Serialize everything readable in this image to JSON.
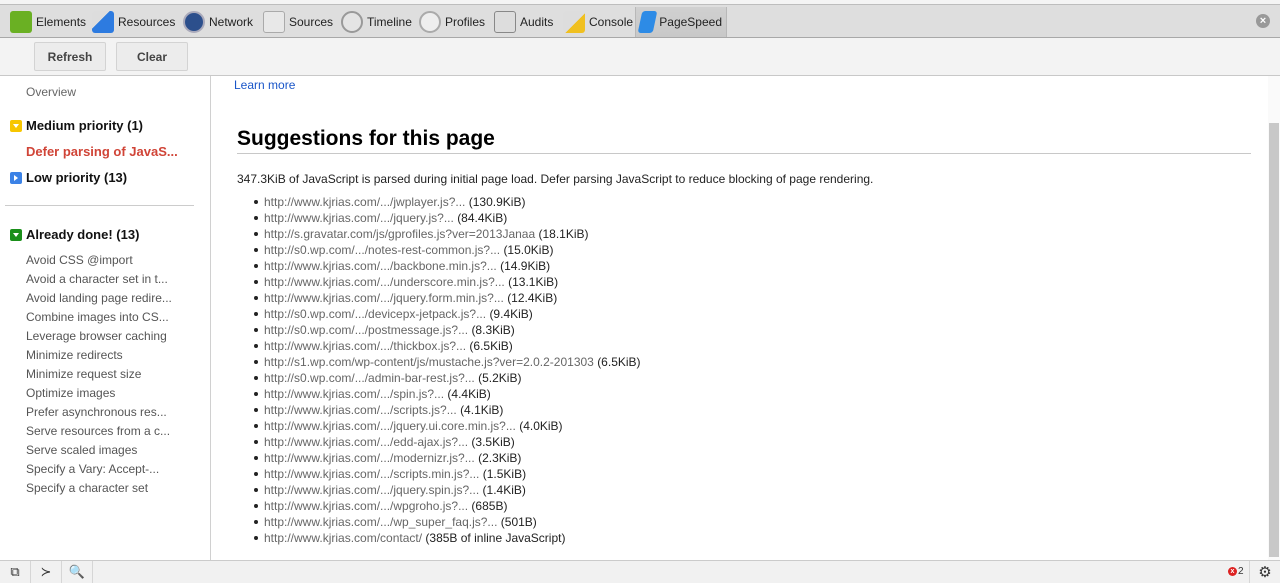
{
  "tabs": [
    {
      "label": "Elements",
      "icon": "elements-icon",
      "color": "#6ab023"
    },
    {
      "label": "Resources",
      "icon": "resources-icon",
      "color": "#2d7be0"
    },
    {
      "label": "Network",
      "icon": "network-icon",
      "color": "#2c4f8c"
    },
    {
      "label": "Sources",
      "icon": "sources-icon",
      "color": "#c9c9c9"
    },
    {
      "label": "Timeline",
      "icon": "timeline-icon",
      "color": "#c9c9c9"
    },
    {
      "label": "Profiles",
      "icon": "profiles-icon",
      "color": "#c9c9c9"
    },
    {
      "label": "Audits",
      "icon": "audits-icon",
      "color": "#c9c9c9"
    },
    {
      "label": "Console",
      "icon": "console-icon",
      "color": "#c9c9c9"
    },
    {
      "label": "PageSpeed",
      "icon": "pagespeed-icon",
      "color": "#2d8be6",
      "active": true
    }
  ],
  "toolbar": {
    "refresh_label": "Refresh",
    "clear_label": "Clear"
  },
  "sidebar": {
    "overview": "Overview",
    "medium": "Medium priority (1)",
    "medium_item": "Defer parsing of JavaS...",
    "low": "Low priority (13)",
    "done": "Already done! (13)",
    "done_items": [
      "Avoid CSS @import",
      "Avoid a character set in t...",
      "Avoid landing page redire...",
      "Combine images into CS...",
      "Leverage browser caching",
      "Minimize redirects",
      "Minimize request size",
      "Optimize images",
      "Prefer asynchronous res...",
      "Serve resources from a c...",
      "Serve scaled images",
      "Specify a Vary: Accept-...",
      "Specify a character set"
    ]
  },
  "main": {
    "learn_more": "Learn more",
    "title": "Suggestions for this page",
    "summary": "347.3KiB of JavaScript is parsed during initial page load. Defer parsing JavaScript to reduce blocking of page rendering.",
    "items": [
      {
        "url": "http://www.kjrias.com/.../jwplayer.js?...",
        "size": "(130.9KiB)"
      },
      {
        "url": "http://www.kjrias.com/.../jquery.js?...",
        "size": "(84.4KiB)"
      },
      {
        "url": "http://s.gravatar.com/js/gprofiles.js?ver=2013Janaa",
        "size": "(18.1KiB)"
      },
      {
        "url": "http://s0.wp.com/.../notes-rest-common.js?...",
        "size": "(15.0KiB)"
      },
      {
        "url": "http://www.kjrias.com/.../backbone.min.js?...",
        "size": "(14.9KiB)"
      },
      {
        "url": "http://www.kjrias.com/.../underscore.min.js?...",
        "size": "(13.1KiB)"
      },
      {
        "url": "http://www.kjrias.com/.../jquery.form.min.js?...",
        "size": "(12.4KiB)"
      },
      {
        "url": "http://s0.wp.com/.../devicepx-jetpack.js?...",
        "size": "(9.4KiB)"
      },
      {
        "url": "http://s0.wp.com/.../postmessage.js?...",
        "size": "(8.3KiB)"
      },
      {
        "url": "http://www.kjrias.com/.../thickbox.js?...",
        "size": "(6.5KiB)"
      },
      {
        "url": "http://s1.wp.com/wp-content/js/mustache.js?ver=2.0.2-201303",
        "size": "(6.5KiB)"
      },
      {
        "url": "http://s0.wp.com/.../admin-bar-rest.js?...",
        "size": "(5.2KiB)"
      },
      {
        "url": "http://www.kjrias.com/.../spin.js?...",
        "size": "(4.4KiB)"
      },
      {
        "url": "http://www.kjrias.com/.../scripts.js?...",
        "size": "(4.1KiB)"
      },
      {
        "url": "http://www.kjrias.com/.../jquery.ui.core.min.js?...",
        "size": "(4.0KiB)"
      },
      {
        "url": "http://www.kjrias.com/.../edd-ajax.js?...",
        "size": "(3.5KiB)"
      },
      {
        "url": "http://www.kjrias.com/.../modernizr.js?...",
        "size": "(2.3KiB)"
      },
      {
        "url": "http://www.kjrias.com/.../scripts.min.js?...",
        "size": "(1.5KiB)"
      },
      {
        "url": "http://www.kjrias.com/.../jquery.spin.js?...",
        "size": "(1.4KiB)"
      },
      {
        "url": "http://www.kjrias.com/.../wpgroho.js?...",
        "size": "(685B)"
      },
      {
        "url": "http://www.kjrias.com/.../wp_super_faq.js?...",
        "size": "(501B)"
      },
      {
        "url": "http://www.kjrias.com/contact/",
        "size": "(385B of inline JavaScript)"
      }
    ]
  },
  "status": {
    "error_count": "2",
    "error_icon": "x",
    "close_glyph": "×",
    "dock_glyph": "⧉",
    "console_glyph": "≻",
    "search_glyph": "🔍",
    "gear_glyph": "⚙"
  }
}
